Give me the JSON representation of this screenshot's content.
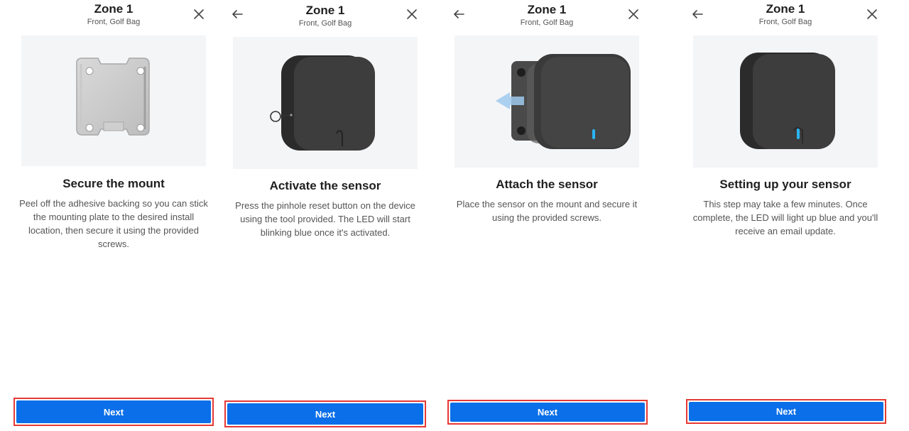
{
  "panels": [
    {
      "title": "Zone 1",
      "subtitle": "Front, Golf Bag",
      "heading": "Secure the mount",
      "description": "Peel off the adhesive backing so you can stick the mounting plate to the desired install location, then secure it using the provided screws.",
      "next_label": "Next",
      "illustration": "mounting-plate",
      "has_back": false
    },
    {
      "title": "Zone 1",
      "subtitle": "Front, Golf Bag",
      "heading": "Activate the sensor",
      "description": "Press the pinhole reset button on the device using the tool provided. The LED will start blinking blue once it's activated.",
      "next_label": "Next",
      "illustration": "sensor-with-pin-tool",
      "has_back": true
    },
    {
      "title": "Zone 1",
      "subtitle": "Front, Golf Bag",
      "heading": "Attach the sensor",
      "description": "Place the sensor on the mount and secure it using the provided screws.",
      "next_label": "Next",
      "illustration": "sensor-attaching-to-mount",
      "has_back": true
    },
    {
      "title": "Zone 1",
      "subtitle": "Front, Golf Bag",
      "heading": "Setting up your sensor",
      "description": "This step may take a few minutes. Once complete, the LED will light up blue and you'll receive an email update.",
      "next_label": "Next",
      "illustration": "sensor-led-blue",
      "has_back": true
    }
  ],
  "icons": {
    "back": "arrow-left-icon",
    "close": "close-icon"
  },
  "colors": {
    "primary_button": "#0a6fe8",
    "highlight_border": "#e53935",
    "illustration_bg": "#f4f5f7",
    "led_blue": "#29b6f6",
    "sensor_body": "#3a3a3a"
  }
}
